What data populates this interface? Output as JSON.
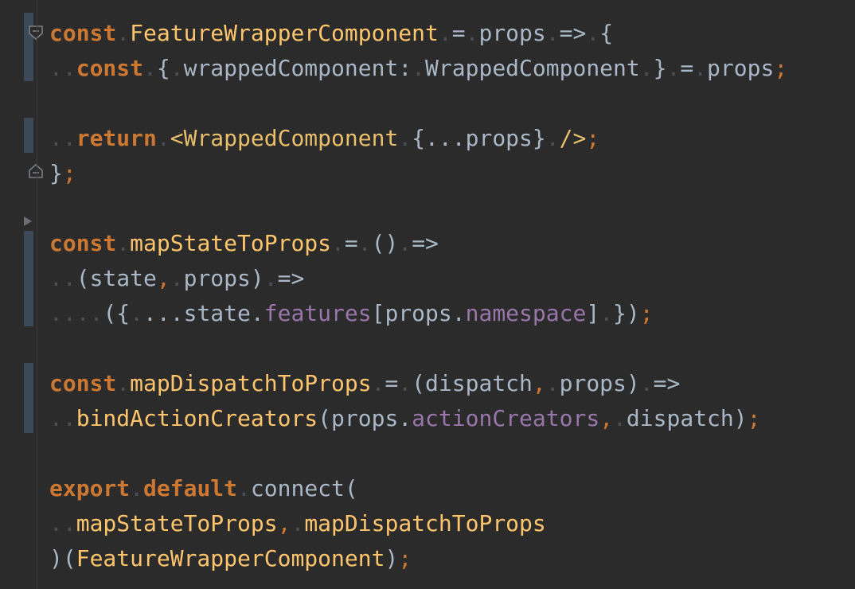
{
  "editor": {
    "lines": [
      [
        {
          "t": "const",
          "c": "kw"
        },
        {
          "t": ".",
          "c": "ws"
        },
        {
          "t": "FeatureWrapperComponent",
          "c": "fn"
        },
        {
          "t": ".",
          "c": "ws"
        },
        {
          "t": "=",
          "c": "punct"
        },
        {
          "t": ".",
          "c": "ws"
        },
        {
          "t": "props",
          "c": "id"
        },
        {
          "t": ".",
          "c": "ws"
        },
        {
          "t": "=>",
          "c": "punct"
        },
        {
          "t": ".",
          "c": "ws"
        },
        {
          "t": "{",
          "c": "punct"
        }
      ],
      [
        {
          "t": "..",
          "c": "ws"
        },
        {
          "t": "const",
          "c": "kw"
        },
        {
          "t": ".",
          "c": "ws"
        },
        {
          "t": "{",
          "c": "punct"
        },
        {
          "t": ".",
          "c": "ws"
        },
        {
          "t": "wrappedComponent:",
          "c": "id"
        },
        {
          "t": ".",
          "c": "ws"
        },
        {
          "t": "WrappedComponent",
          "c": "id"
        },
        {
          "t": ".",
          "c": "ws"
        },
        {
          "t": "}",
          "c": "punct"
        },
        {
          "t": ".",
          "c": "ws"
        },
        {
          "t": "=",
          "c": "punct"
        },
        {
          "t": ".",
          "c": "ws"
        },
        {
          "t": "props",
          "c": "id"
        },
        {
          "t": ";",
          "c": "semi"
        }
      ],
      [],
      [
        {
          "t": "..",
          "c": "ws"
        },
        {
          "t": "return",
          "c": "kw"
        },
        {
          "t": ".",
          "c": "ws"
        },
        {
          "t": "<WrappedComponent",
          "c": "tag"
        },
        {
          "t": ".",
          "c": "ws"
        },
        {
          "t": "{...props}",
          "c": "id"
        },
        {
          "t": ".",
          "c": "ws"
        },
        {
          "t": "/>",
          "c": "tag"
        },
        {
          "t": ";",
          "c": "semi"
        }
      ],
      [
        {
          "t": "}",
          "c": "punct"
        },
        {
          "t": ";",
          "c": "semi"
        }
      ],
      [],
      [
        {
          "t": "const",
          "c": "kw"
        },
        {
          "t": ".",
          "c": "ws"
        },
        {
          "t": "mapStateToProps",
          "c": "fn"
        },
        {
          "t": ".",
          "c": "ws"
        },
        {
          "t": "=",
          "c": "punct"
        },
        {
          "t": ".",
          "c": "ws"
        },
        {
          "t": "()",
          "c": "punct"
        },
        {
          "t": ".",
          "c": "ws"
        },
        {
          "t": "=>",
          "c": "punct"
        }
      ],
      [
        {
          "t": "..",
          "c": "ws"
        },
        {
          "t": "(state",
          "c": "id"
        },
        {
          "t": ",",
          "c": "comma"
        },
        {
          "t": ".",
          "c": "ws"
        },
        {
          "t": "props)",
          "c": "id"
        },
        {
          "t": ".",
          "c": "ws"
        },
        {
          "t": "=>",
          "c": "punct"
        }
      ],
      [
        {
          "t": "....",
          "c": "ws"
        },
        {
          "t": "({",
          "c": "punct"
        },
        {
          "t": ".",
          "c": "ws"
        },
        {
          "t": "...state.",
          "c": "id"
        },
        {
          "t": "features",
          "c": "prop"
        },
        {
          "t": "[props.",
          "c": "id"
        },
        {
          "t": "namespace",
          "c": "prop"
        },
        {
          "t": "]",
          "c": "id"
        },
        {
          "t": ".",
          "c": "ws"
        },
        {
          "t": "})",
          "c": "punct"
        },
        {
          "t": ";",
          "c": "semi"
        }
      ],
      [],
      [
        {
          "t": "const",
          "c": "kw"
        },
        {
          "t": ".",
          "c": "ws"
        },
        {
          "t": "mapDispatchToProps",
          "c": "fn"
        },
        {
          "t": ".",
          "c": "ws"
        },
        {
          "t": "=",
          "c": "punct"
        },
        {
          "t": ".",
          "c": "ws"
        },
        {
          "t": "(dispatch",
          "c": "id"
        },
        {
          "t": ",",
          "c": "comma"
        },
        {
          "t": ".",
          "c": "ws"
        },
        {
          "t": "props)",
          "c": "id"
        },
        {
          "t": ".",
          "c": "ws"
        },
        {
          "t": "=>",
          "c": "punct"
        }
      ],
      [
        {
          "t": "..",
          "c": "ws"
        },
        {
          "t": "bindActionCreators",
          "c": "fn"
        },
        {
          "t": "(props.",
          "c": "id"
        },
        {
          "t": "actionCreators",
          "c": "prop"
        },
        {
          "t": ",",
          "c": "comma"
        },
        {
          "t": ".",
          "c": "ws"
        },
        {
          "t": "dispatch)",
          "c": "id"
        },
        {
          "t": ";",
          "c": "semi"
        }
      ],
      [],
      [
        {
          "t": "export",
          "c": "kw"
        },
        {
          "t": ".",
          "c": "ws"
        },
        {
          "t": "default",
          "c": "kw"
        },
        {
          "t": ".",
          "c": "ws"
        },
        {
          "t": "connect(",
          "c": "id"
        }
      ],
      [
        {
          "t": "..",
          "c": "ws"
        },
        {
          "t": "mapStateToProps",
          "c": "fn"
        },
        {
          "t": ",",
          "c": "comma"
        },
        {
          "t": ".",
          "c": "ws"
        },
        {
          "t": "mapDispatchToProps",
          "c": "fn"
        }
      ],
      [
        {
          "t": ")(",
          "c": "id"
        },
        {
          "t": "FeatureWrapperComponent",
          "c": "fn"
        },
        {
          "t": ")",
          "c": "id"
        },
        {
          "t": ";",
          "c": "semi"
        }
      ]
    ]
  },
  "gutter": {
    "fold_open_icon": "fold-open-icon",
    "fold_close_icon": "fold-close-icon",
    "collapsed_marker_icon": "collapsed-arrow-icon"
  },
  "colors": {
    "background": "#2b2b2b",
    "keyword": "#cc7832",
    "function": "#ffc66d",
    "identifier": "#a9b7c6",
    "property": "#9876aa",
    "whitespace_marker": "#4b5056"
  }
}
